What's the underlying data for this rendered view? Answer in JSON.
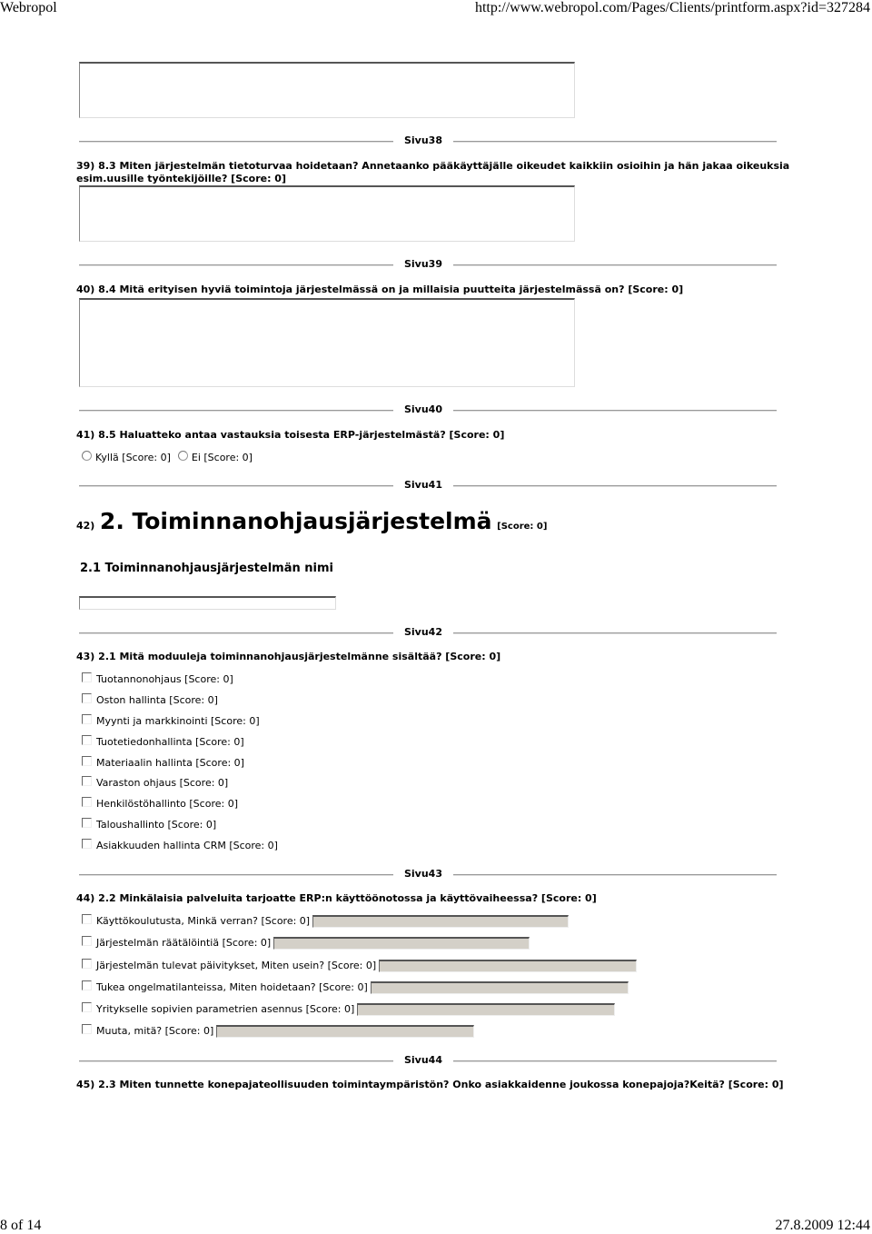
{
  "header": {
    "app_name": "Webropol",
    "url": "http://www.webropol.com/Pages/Clients/printform.aspx?id=327284"
  },
  "footer": {
    "page_indicator": "8 of 14",
    "datetime": "27.8.2009 12:44"
  },
  "sections": {
    "s38": "Sivu38",
    "s39": "Sivu39",
    "s40": "Sivu40",
    "s41": "Sivu41",
    "s42": "Sivu42",
    "s43": "Sivu43",
    "s44": "Sivu44"
  },
  "questions": {
    "q39": {
      "line1": "39) 8.3 Miten järjestelmän tietoturvaa hoidetaan? Annetaanko pääkäyttäjälle oikeudet kaikkiin osioihin ja hän jakaa oikeuksia",
      "line2": "esim.uusille työntekijöille? [Score: 0]",
      "answer": ""
    },
    "q40": {
      "text": "40) 8.4 Mitä erityisen hyviä toimintoja järjestelmässä on ja millaisia puutteita järjestelmässä on? [Score: 0]",
      "answer": ""
    },
    "q41": {
      "text": "41) 8.5 Haluatteko antaa vastauksia toisesta ERP-järjestelmästä? [Score: 0]",
      "options": [
        {
          "label": "Kyllä [Score: 0]",
          "selected": false
        },
        {
          "label": "Ei [Score: 0]",
          "selected": false
        }
      ]
    },
    "q42": {
      "number": "42)",
      "title": "2. Toiminnanohjausjärjestelmä",
      "score": "[Score: 0]",
      "subheading": "2.1 Toiminnanohjausjärjestelmän nimi",
      "answer": ""
    },
    "q43": {
      "text": "43) 2.1 Mitä moduuleja toiminnanohjausjärjestelmänne sisältää? [Score: 0]",
      "options": [
        {
          "label": "Tuotannonohjaus [Score: 0]",
          "checked": false
        },
        {
          "label": "Oston hallinta [Score: 0]",
          "checked": false
        },
        {
          "label": "Myynti ja markkinointi [Score: 0]",
          "checked": false
        },
        {
          "label": "Tuotetiedonhallinta [Score: 0]",
          "checked": false
        },
        {
          "label": "Materiaalin hallinta [Score: 0]",
          "checked": false
        },
        {
          "label": "Varaston ohjaus [Score: 0]",
          "checked": false
        },
        {
          "label": "Henkilöstöhallinto [Score: 0]",
          "checked": false
        },
        {
          "label": "Taloushallinto [Score: 0]",
          "checked": false
        },
        {
          "label": "Asiakkuuden hallinta CRM [Score: 0]",
          "checked": false
        }
      ]
    },
    "q44": {
      "text": "44) 2.2 Minkälaisia palveluita tarjoatte ERP:n käyttöönotossa ja käyttövaiheessa? [Score: 0]",
      "options": [
        {
          "label": "Käyttökoulutusta, Minkä verran? [Score: 0]",
          "checked": false,
          "value": ""
        },
        {
          "label": "Järjestelmän räätälöintiä [Score: 0]",
          "checked": false,
          "value": ""
        },
        {
          "label": "Järjestelmän tulevat päivitykset, Miten usein? [Score: 0]",
          "checked": false,
          "value": ""
        },
        {
          "label": "Tukea ongelmatilanteissa, Miten hoidetaan? [Score: 0]",
          "checked": false,
          "value": ""
        },
        {
          "label": "Yritykselle sopivien parametrien asennus [Score: 0]",
          "checked": false,
          "value": ""
        },
        {
          "label": "Muuta, mitä? [Score: 0]",
          "checked": false,
          "value": ""
        }
      ]
    },
    "q45": {
      "text": "45) 2.3 Miten tunnette konepajateollisuuden toimintaympäristön? Onko asiakkaidenne joukossa konepajoja?Keitä? [Score: 0]"
    }
  }
}
